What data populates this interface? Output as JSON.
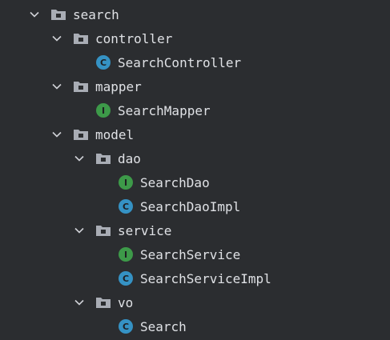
{
  "colors": {
    "background": "#2b2d30",
    "text": "#dfe1e5",
    "chevron": "#cfd1d6",
    "folder": "#a9adb5",
    "class_badge": "#3592c4",
    "interface_badge": "#3d9a49"
  },
  "tree": [
    {
      "label": "search",
      "kind": "folder",
      "expanded": true,
      "icon": "folder-icon"
    },
    {
      "label": "controller",
      "kind": "folder",
      "expanded": true,
      "icon": "folder-icon"
    },
    {
      "label": "SearchController",
      "kind": "class",
      "badge": "C",
      "icon": "class-icon"
    },
    {
      "label": "mapper",
      "kind": "folder",
      "expanded": true,
      "icon": "folder-icon"
    },
    {
      "label": "SearchMapper",
      "kind": "interface",
      "badge": "I",
      "icon": "interface-icon"
    },
    {
      "label": "model",
      "kind": "folder",
      "expanded": true,
      "icon": "folder-icon"
    },
    {
      "label": "dao",
      "kind": "folder",
      "expanded": true,
      "icon": "folder-icon"
    },
    {
      "label": "SearchDao",
      "kind": "interface",
      "badge": "I",
      "icon": "interface-icon"
    },
    {
      "label": "SearchDaoImpl",
      "kind": "class",
      "badge": "C",
      "icon": "class-icon"
    },
    {
      "label": "service",
      "kind": "folder",
      "expanded": true,
      "icon": "folder-icon"
    },
    {
      "label": "SearchService",
      "kind": "interface",
      "badge": "I",
      "icon": "interface-icon"
    },
    {
      "label": "SearchServiceImpl",
      "kind": "class",
      "badge": "C",
      "icon": "class-icon"
    },
    {
      "label": "vo",
      "kind": "folder",
      "expanded": true,
      "icon": "folder-icon"
    },
    {
      "label": "Search",
      "kind": "class",
      "badge": "C",
      "icon": "class-icon"
    }
  ]
}
